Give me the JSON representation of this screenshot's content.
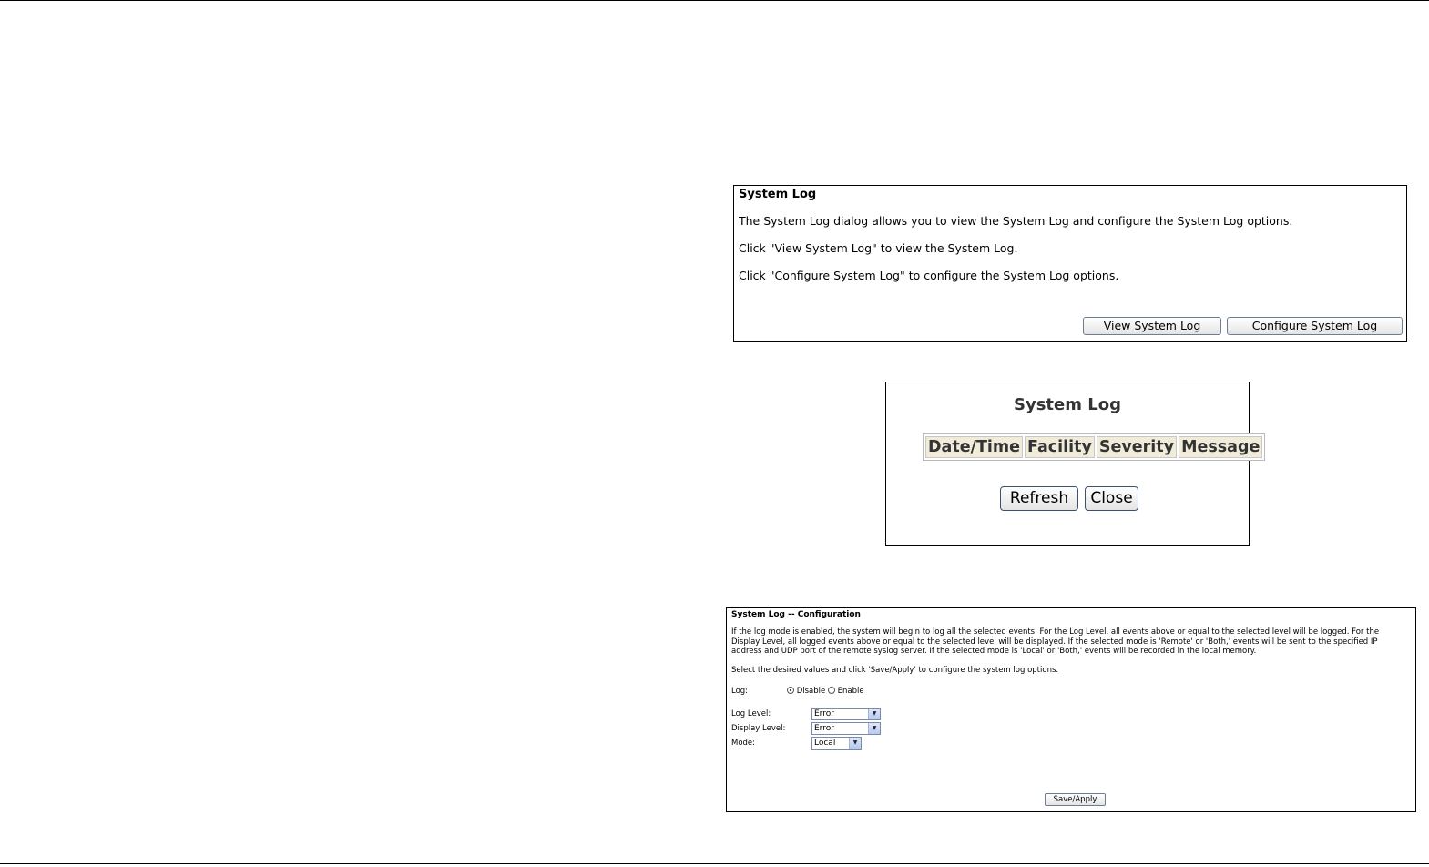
{
  "panel1": {
    "title": "System Log",
    "line1": "The System Log dialog allows you to view the System Log and configure the System Log options.",
    "line2": "Click \"View System Log\" to view the System Log.",
    "line3": "Click \"Configure System Log\" to configure the System Log options.",
    "view_button": "View System Log",
    "configure_button": "Configure System Log"
  },
  "panel2": {
    "title": "System Log",
    "columns": [
      "Date/Time",
      "Facility",
      "Severity",
      "Message"
    ],
    "refresh_button": "Refresh",
    "close_button": "Close"
  },
  "panel3": {
    "title": "System Log -- Configuration",
    "description": "If the log mode is enabled, the system will begin to log all the selected events. For the Log Level, all events above or equal to the selected level will be logged. For the Display Level, all logged events above or equal to the selected level will be displayed. If the selected mode is 'Remote' or 'Both,' events will be sent to the specified IP address and UDP port of the remote syslog server. If the selected mode is 'Local' or 'Both,' events will be recorded in the local memory.",
    "instruction": "Select the desired values and click 'Save/Apply' to configure the system log options.",
    "log_label": "Log:",
    "disable_label": "Disable",
    "enable_label": "Enable",
    "log_selected": "Disable",
    "log_level_label": "Log Level:",
    "log_level_value": "Error",
    "display_level_label": "Display Level:",
    "display_level_value": "Error",
    "mode_label": "Mode:",
    "mode_value": "Local",
    "save_button": "Save/Apply"
  }
}
